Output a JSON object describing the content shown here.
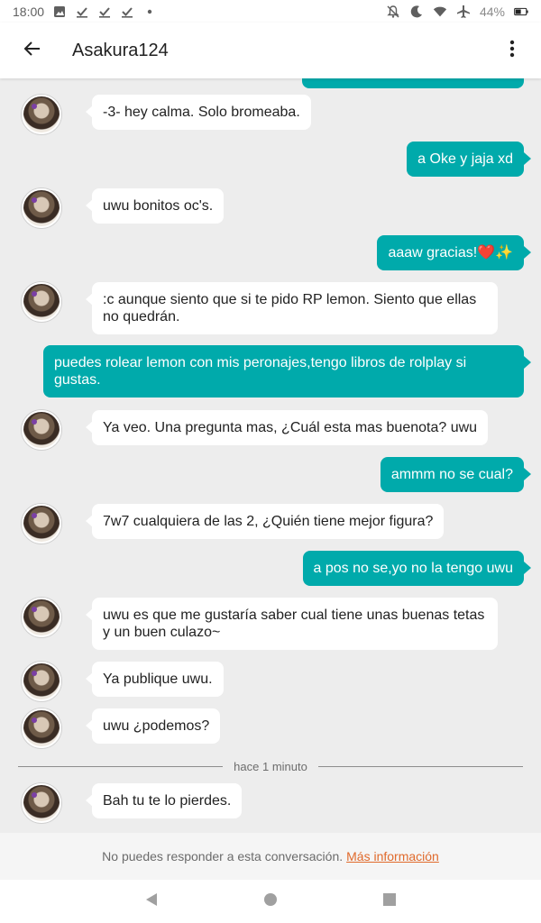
{
  "status_bar": {
    "time": "18:00",
    "battery": "44%",
    "icons": [
      "image-icon",
      "check-icon",
      "check-icon",
      "check-icon",
      "dot-icon",
      "notifications-off-icon",
      "moon-icon",
      "wifi-icon",
      "airplane-icon",
      "battery-icon"
    ]
  },
  "header": {
    "title": "Asakura124",
    "back_icon": "arrow-back-icon",
    "more_icon": "more-vert-icon"
  },
  "messages": [
    {
      "dir": "in",
      "text": "-3- hey calma. Solo bromeaba."
    },
    {
      "dir": "out",
      "text": "a Oke y jaja xd"
    },
    {
      "dir": "in",
      "text": "uwu bonitos oc's."
    },
    {
      "dir": "out",
      "text": "aaaw gracias!❤️✨"
    },
    {
      "dir": "in",
      "text": ":c aunque siento que si te pido RP lemon. Siento que ellas no quedrán."
    },
    {
      "dir": "out",
      "text": "puedes rolear lemon con mis peronajes,tengo libros de rolplay si gustas."
    },
    {
      "dir": "in",
      "text": "Ya veo. Una pregunta mas, ¿Cuál esta mas buenota? uwu"
    },
    {
      "dir": "out",
      "text": "ammm no se cual?"
    },
    {
      "dir": "in",
      "text": "7w7 cualquiera de las 2, ¿Quién tiene mejor figura?"
    },
    {
      "dir": "out",
      "text": "a pos no se,yo no la tengo uwu"
    },
    {
      "dir": "in",
      "text": "uwu es que me gustaría saber cual tiene unas buenas tetas y un buen culazo~"
    },
    {
      "dir": "in",
      "text": "Ya publique uwu."
    },
    {
      "dir": "in",
      "text": "uwu ¿podemos?"
    },
    {
      "dir": "in",
      "text": "Bah tu te lo pierdes."
    }
  ],
  "divider": "hace 1 minuto",
  "footer": {
    "text": "No puedes responder a esta conversación.",
    "link": "Más información"
  },
  "nav": {
    "back_icon": "nav-back-icon",
    "home_icon": "nav-home-icon",
    "recents_icon": "nav-recents-icon"
  },
  "colors": {
    "outgoing_bubble": "#00aaab",
    "incoming_bubble": "#ffffff",
    "chat_background": "#ededed",
    "link": "#e06a2c"
  }
}
